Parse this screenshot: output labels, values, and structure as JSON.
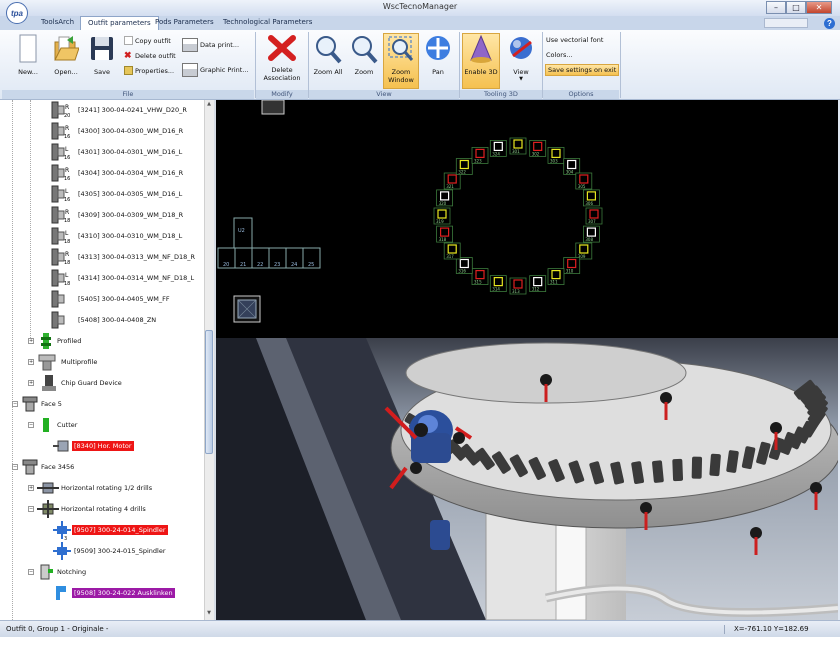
{
  "window": {
    "title": "WscTecnoManager",
    "minimize": "–",
    "maximize": "□",
    "close": "✕"
  },
  "app_logo": "tpa",
  "tabs": [
    {
      "label": "ToolsArch",
      "active": false
    },
    {
      "label": "Outfit parameters",
      "active": true
    },
    {
      "label": "Pods Parameters",
      "active": false
    },
    {
      "label": "Technological Parameters",
      "active": false
    }
  ],
  "help_label": "?",
  "ribbon": {
    "file": {
      "label": "File",
      "new": "New...",
      "open": "Open...",
      "save": "Save",
      "copy_outfit": "Copy outfit",
      "delete_outfit": "Delete outfit",
      "properties": "Properties...",
      "data_print": "Data print...",
      "graphic_print": "Graphic Print..."
    },
    "modify": {
      "label": "Modify",
      "delete_association": "Delete Association"
    },
    "view": {
      "label": "View",
      "zoom_all": "Zoom All",
      "zoom": "Zoom",
      "zoom_window": "Zoom Window",
      "pan": "Pan"
    },
    "tooling3d": {
      "label": "Tooling 3D",
      "enable_3d": "Enable 3D",
      "view": "View"
    },
    "options": {
      "label": "Options",
      "vectorial_font": "Use vectorial font",
      "colors": "Colors...",
      "save_settings": "Save settings on exit"
    }
  },
  "tree": {
    "tools": [
      {
        "id": "[3241] 300-04-0241_VHW_D20_R",
        "badge": "R",
        "dia": "20"
      },
      {
        "id": "[4300] 300-04-0300_WM_D16_R",
        "badge": "R",
        "dia": "16"
      },
      {
        "id": "[4301] 300-04-0301_WM_D16_L",
        "badge": "L",
        "dia": "16"
      },
      {
        "id": "[4304] 300-04-0304_WM_D16_R",
        "badge": "R",
        "dia": "16"
      },
      {
        "id": "[4305] 300-04-0305_WM_D16_L",
        "badge": "L",
        "dia": "16"
      },
      {
        "id": "[4309] 300-04-0309_WM_D18_R",
        "badge": "R",
        "dia": "18"
      },
      {
        "id": "[4310] 300-04-0310_WM_D18_L",
        "badge": "L",
        "dia": "18"
      },
      {
        "id": "[4313] 300-04-0313_WM_NF_D18_R",
        "badge": "R",
        "dia": "18"
      },
      {
        "id": "[4314] 300-04-0314_WM_NF_D18_L",
        "badge": "L",
        "dia": "18"
      },
      {
        "id": "[5405] 300-04-0405_WM_FF",
        "badge": "",
        "dia": ""
      },
      {
        "id": "[5408] 300-04-0408_ZN",
        "badge": "",
        "dia": ""
      }
    ],
    "profiled": "Profiled",
    "multiprofile": "Multiprofile",
    "chip_guard": "Chip Guard Device",
    "face5": "Face 5",
    "cutter": "Cutter",
    "face5_tool": "[8340] Hor. Motor",
    "face3456": "Face 3456",
    "hor_rot_1_2": "Horizontal rotating 1/2 drills",
    "hor_rot_4": "Horizontal rotating 4 drills",
    "spindle_red": "[9507] 300-24-014_Spindler",
    "spindle_num": "3",
    "spindle_plain": "[9509] 300-24-015_Spindler",
    "notching": "Notching",
    "notch_tool": "[9508] 300-24-022 Ausklinken"
  },
  "status": {
    "left": "Outfit 0, Group 1 - Originale -",
    "coords": "X=-761.10 Y=182.69"
  },
  "top_view": {
    "left_block_top": "U2",
    "left_block_cells": [
      "20",
      "21",
      "22",
      "23",
      "24",
      "25"
    ],
    "ring_labels": [
      "301",
      "302",
      "303",
      "304",
      "305",
      "306",
      "307",
      "308",
      "309",
      "310",
      "311",
      "312",
      "313",
      "314",
      "315",
      "316",
      "317",
      "318",
      "319",
      "320",
      "321",
      "322",
      "323",
      "324"
    ]
  },
  "colors": {
    "accent": "#2d6ed2",
    "tree_red": "#ee1515",
    "tree_purple": "#9c1aa6",
    "highlight": "#f5c150"
  }
}
